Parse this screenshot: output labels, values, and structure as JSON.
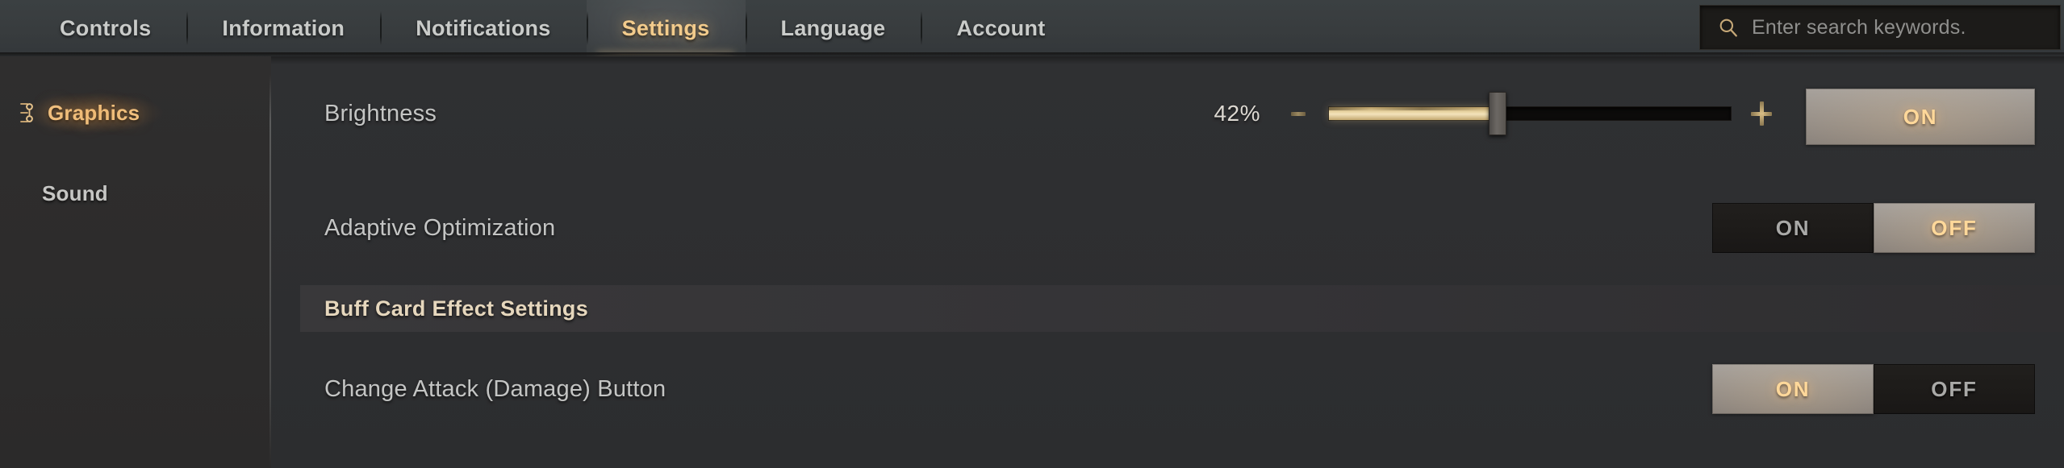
{
  "topbar": {
    "tabs": [
      {
        "label": "Controls",
        "active": false
      },
      {
        "label": "Information",
        "active": false
      },
      {
        "label": "Notifications",
        "active": false
      },
      {
        "label": "Settings",
        "active": true
      },
      {
        "label": "Language",
        "active": false
      },
      {
        "label": "Account",
        "active": false
      }
    ],
    "search": {
      "placeholder": "Enter search keywords.",
      "value": "",
      "icon": "search-icon"
    }
  },
  "sidebar": {
    "items": [
      {
        "label": "Graphics",
        "active": true,
        "icon": "ornament-icon"
      },
      {
        "label": "Sound",
        "active": false,
        "icon": ""
      }
    ]
  },
  "content": {
    "rows": [
      {
        "label": "Brightness",
        "control": "slider",
        "value_text": "42%",
        "value": 42,
        "min": 0,
        "max": 100,
        "decrease_label": "−",
        "increase_label": "+",
        "toggle": {
          "label": "ON",
          "selected": true
        }
      },
      {
        "label": "Adaptive Optimization",
        "control": "toggle",
        "options": [
          {
            "label": "ON",
            "selected": false
          },
          {
            "label": "OFF",
            "selected": true
          }
        ]
      }
    ],
    "section": {
      "title": "Buff Card Effect Settings",
      "rows": [
        {
          "label": "Change Attack (Damage) Button",
          "control": "toggle",
          "options": [
            {
              "label": "ON",
              "selected": true
            },
            {
              "label": "OFF",
              "selected": false
            }
          ]
        }
      ]
    }
  },
  "colors": {
    "accent_gold": "#f2cb8c",
    "slider_fill": "#e8d3a1",
    "text_primary": "#c4c5c4",
    "panel_bg": "#2c2d2f"
  }
}
